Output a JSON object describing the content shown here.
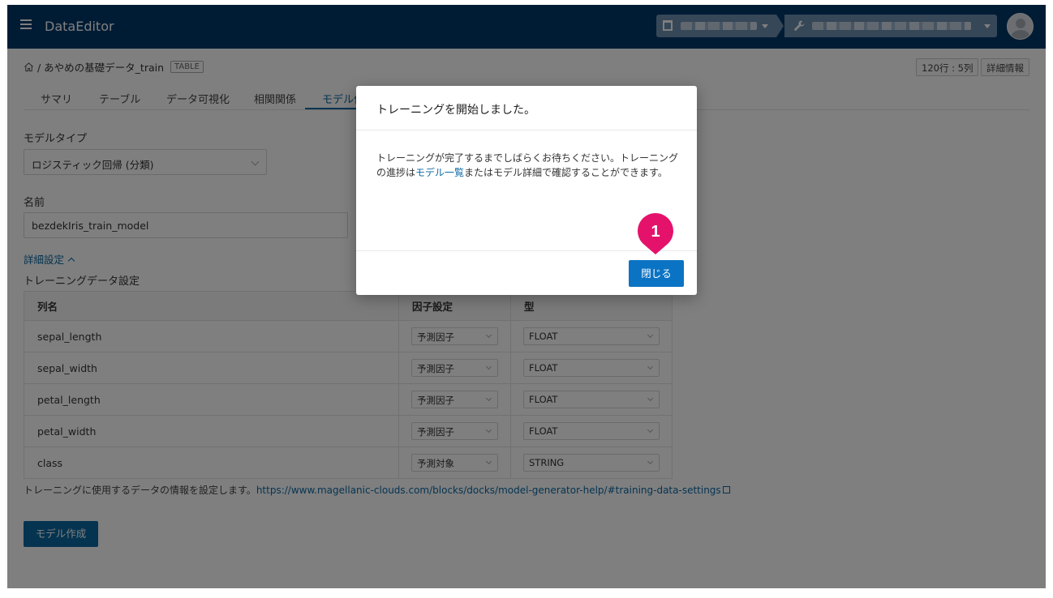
{
  "header": {
    "app_title": "DataEditor"
  },
  "breadcrumb": {
    "path": "/ あやめの基礎データ_train",
    "tag": "TABLE"
  },
  "meta": {
    "size": "120行 : 5列",
    "details": "詳細情報"
  },
  "tabs": [
    {
      "label": "サマリ"
    },
    {
      "label": "テーブル"
    },
    {
      "label": "データ可視化"
    },
    {
      "label": "相関関係"
    },
    {
      "label": "モデル作"
    }
  ],
  "form": {
    "model_type_label": "モデルタイプ",
    "model_type_value": "ロジスティック回帰 (分類)",
    "name_label": "名前",
    "name_value": "bezdekIris_train_model",
    "advanced_toggle": "詳細設定",
    "training_data_label": "トレーニングデータ設定"
  },
  "table": {
    "headers": [
      "列名",
      "因子設定",
      "型"
    ],
    "rows": [
      {
        "name": "sepal_length",
        "factor": "予測因子",
        "type": "FLOAT"
      },
      {
        "name": "sepal_width",
        "factor": "予測因子",
        "type": "FLOAT"
      },
      {
        "name": "petal_length",
        "factor": "予測因子",
        "type": "FLOAT"
      },
      {
        "name": "petal_width",
        "factor": "予測因子",
        "type": "FLOAT"
      },
      {
        "name": "class",
        "factor": "予測対象",
        "type": "STRING"
      }
    ]
  },
  "note": {
    "text": "トレーニングに使用するデータの情報を設定します。",
    "link": "https://www.magellanic-clouds.com/blocks/docks/model-generator-help/#training-data-settings"
  },
  "create_button": "モデル作成",
  "modal": {
    "title": "トレーニングを開始しました。",
    "body_before": "トレーニングが完了するまでしばらくお待ちください。トレーニングの進捗は",
    "body_link": "モデル一覧",
    "body_after": "またはモデル詳細で確認することができます。",
    "close_label": "閉じる"
  },
  "step_badge": "1",
  "colors": {
    "header_bg": "#00386b",
    "accent": "#0b69a3",
    "badge": "#e5126b"
  }
}
